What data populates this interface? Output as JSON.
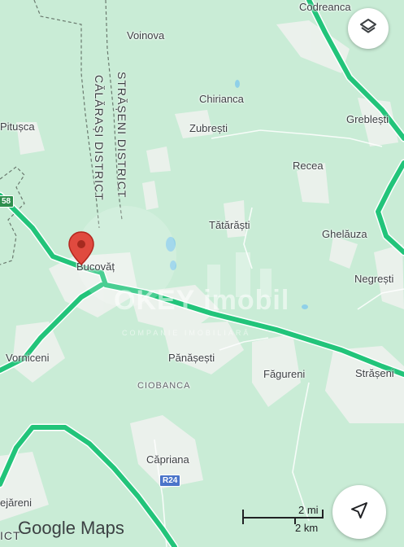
{
  "places": {
    "codreanca": "Codreanca",
    "voinova": "Voinova",
    "pitusca": "Pitușca",
    "chirianca": "Chirianca",
    "zubresti": "Zubrești",
    "greblesti": "Greblești",
    "recea": "Recea",
    "tatarasti": "Tătărăști",
    "ghelauza": "Ghelăuza",
    "negresti": "Negrești",
    "bucovat": "Bucovăț",
    "vorniceni": "Vorniceni",
    "panasesti": "Pănășești",
    "fagureni": "Făgureni",
    "straseni": "Strășeni",
    "ciobanca": "CIOBANCA",
    "capriana": "Căpriana",
    "lejareni": "ejăreni"
  },
  "districts": {
    "calarasi": "CĂLĂRAȘI DISTRICT",
    "straseni": "STRĂȘENI DISTRICT",
    "corner": "ICT"
  },
  "roads": {
    "r24": "R24",
    "m58": "58"
  },
  "watermark": {
    "brand": "OKEY imobil",
    "tagline": "COMPANIE IMOBILIARĂ"
  },
  "scale": {
    "miles": "2 mi",
    "km": "2 km"
  },
  "branding": "Google Maps",
  "icons": {
    "layers": "layers-icon",
    "navigate": "navigation-arrow-icon",
    "pin": "location-pin-icon"
  },
  "colors": {
    "land": "#c9ecd6",
    "road": "#22c47a",
    "pin": "#e04a3f"
  }
}
